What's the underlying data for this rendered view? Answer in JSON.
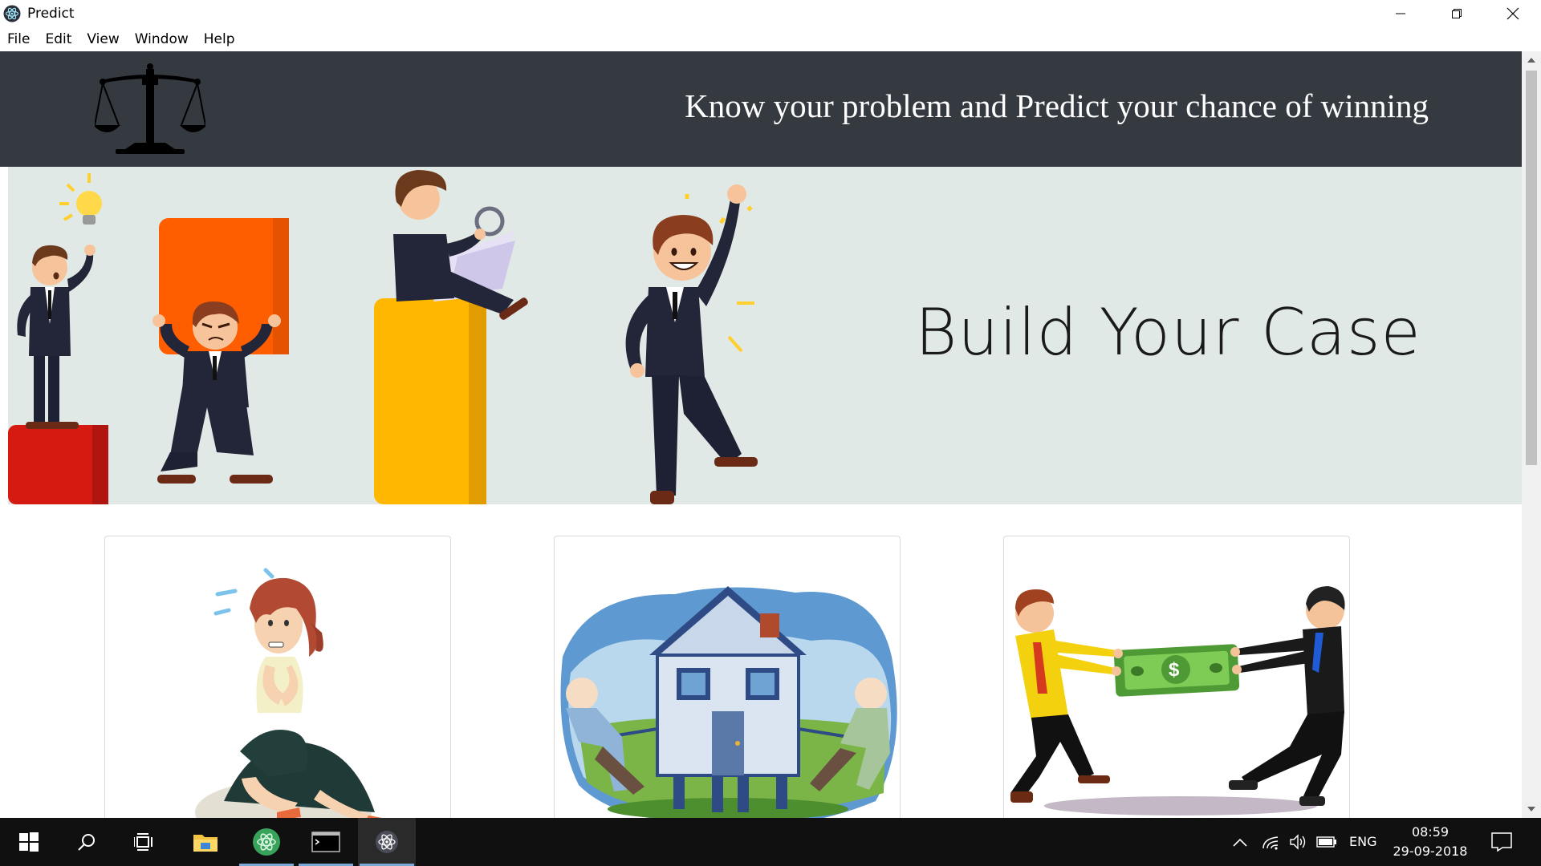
{
  "window": {
    "title": "Predict",
    "app_icon": "electron-atom-icon"
  },
  "menu": {
    "items": [
      "File",
      "Edit",
      "View",
      "Window",
      "Help"
    ]
  },
  "header": {
    "logo": "scales-of-justice-icon",
    "tagline": "Know your problem and Predict your chance of winning",
    "background": "#343a40"
  },
  "hero": {
    "title": "Build Your Case",
    "background": "#e1e9e6"
  },
  "cards": [
    {
      "illustration": "worried-woman-illustration"
    },
    {
      "illustration": "property-dispute-illustration"
    },
    {
      "illustration": "money-tug-of-war-illustration"
    }
  ],
  "taskbar": {
    "language": "ENG",
    "time": "08:59",
    "date": "29-09-2018",
    "accent": "#7aa7d6"
  }
}
